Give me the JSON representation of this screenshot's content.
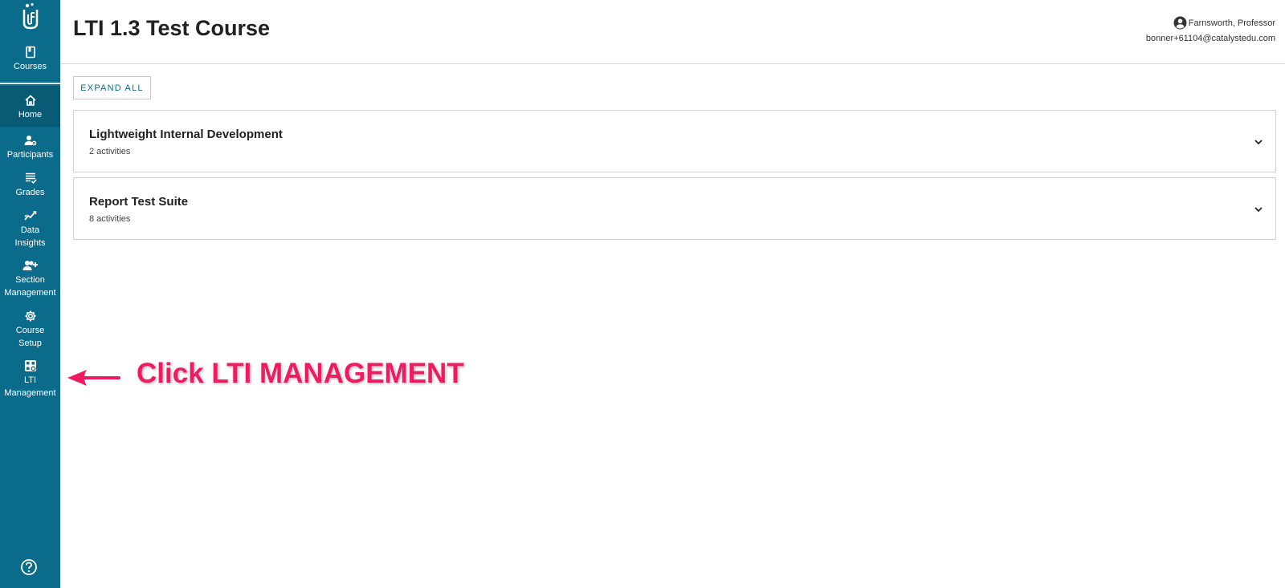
{
  "sidebar": {
    "logo_icon": "flask-logo-icon",
    "courses_label": "Courses",
    "items": [
      {
        "label": "Home",
        "icon": "home-icon",
        "active": true
      },
      {
        "label": "Participants",
        "icon": "participants-icon"
      },
      {
        "label": "Grades",
        "icon": "grades-icon"
      },
      {
        "label": "Data\nInsights",
        "icon": "data-insights-icon"
      },
      {
        "label": "Section\nManagement",
        "icon": "section-management-icon"
      },
      {
        "label": "Course\nSetup",
        "icon": "gear-icon"
      },
      {
        "label": "LTI\nManagement",
        "icon": "lti-management-icon"
      }
    ],
    "help_icon": "help-icon"
  },
  "header": {
    "title": "LTI 1.3 Test Course",
    "user_name": "Farnsworth, Professor",
    "user_email": "bonner+61104@catalystedu.com"
  },
  "main": {
    "expand_all_label": "EXPAND ALL",
    "units": [
      {
        "title": "Lightweight Internal Development",
        "count": "2 activities"
      },
      {
        "title": "Report Test Suite",
        "count": "8 activities"
      }
    ]
  },
  "annotation": {
    "text": "Click LTI MANAGEMENT",
    "color": "#ee1b62"
  },
  "colors": {
    "sidebar": "#0b6b8b",
    "sidebar_active": "#085a75",
    "accent": "#0b6b8b"
  }
}
